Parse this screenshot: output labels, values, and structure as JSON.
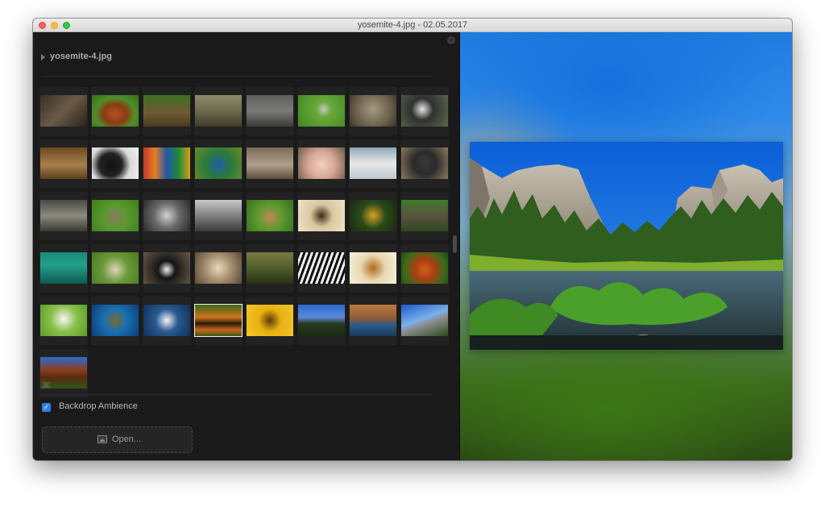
{
  "window": {
    "title": "yosemite-4.jpg - 02.05.2017"
  },
  "sidebar": {
    "file_name": "yosemite-4.jpg",
    "cmd_symbol": "⌘",
    "backdrop_label": "Backdrop Ambience",
    "backdrop_checked": true,
    "checkmark": "✓",
    "open_label": "Open...",
    "selected_index": 35,
    "thumbnails": [
      {
        "name": "thumb-hedgehog",
        "bg": "linear-gradient(135deg,#3a3025,#6a5a48 50%,#2a2218)"
      },
      {
        "name": "thumb-orangutan",
        "bg": "radial-gradient(ellipse at 50% 60%,#b5531d 0%,#8a3a14 35%,#4f8f2a 60%,#3a6d1e 100%)"
      },
      {
        "name": "thumb-deer",
        "bg": "linear-gradient(180deg,#3d6e1f,#6f5a34 55%,#4a3a20)"
      },
      {
        "name": "thumb-crocodile",
        "bg": "linear-gradient(180deg,#8e8a6a,#6e6a4e 50%,#3f3c2a)"
      },
      {
        "name": "thumb-rhino",
        "bg": "linear-gradient(180deg,#606060,#7a7a78 50%,#3b3b3a)"
      },
      {
        "name": "thumb-ostrich",
        "bg": "radial-gradient(circle at 55% 45%,#c7c7c7 0%,#6aa83a 25%,#3f8a22 100%)"
      },
      {
        "name": "thumb-owl",
        "bg": "radial-gradient(circle at 50% 45%,#a59a82,#6a604c 60%,#3a3428)"
      },
      {
        "name": "thumb-panda",
        "bg": "radial-gradient(circle at 45% 45%,#e8e8e8 0%,#303030 35%,#5c6a4e 100%)"
      },
      {
        "name": "thumb-meerkats",
        "bg": "linear-gradient(180deg,#6b4a22,#a8804a 55%,#5a4020)"
      },
      {
        "name": "thumb-bear",
        "bg": "radial-gradient(circle at 40% 55%,#111 0%,#222 35%,#d9d9d9 60%,#f0f0f0 100%)"
      },
      {
        "name": "thumb-parrots",
        "bg": "linear-gradient(90deg,#c0392b,#e67e22 25%,#2255aa 50%,#1e8a3a 75%,#d4a017)"
      },
      {
        "name": "thumb-peacock",
        "bg": "radial-gradient(circle at 50% 55%,#1d5fa8,#2a7a3a 45%,#6a8a2a 100%)"
      },
      {
        "name": "thumb-seal",
        "bg": "linear-gradient(180deg,#7a6a58,#b0a08a 55%,#5a4e40)"
      },
      {
        "name": "thumb-pig",
        "bg": "radial-gradient(circle at 50% 55%,#f2cfc0,#d8a898 45%,#6a5a4a 100%)"
      },
      {
        "name": "thumb-polar-bears",
        "bg": "linear-gradient(180deg,#8fa8b8,#e8e8e8 50%,#bfc8d0)"
      },
      {
        "name": "thumb-porcupine",
        "bg": "radial-gradient(circle at 50% 50%,#3a3a3a,#2a2a2a 40%,#8a7a60 100%)"
      },
      {
        "name": "thumb-opossum",
        "bg": "linear-gradient(180deg,#4a4a44,#8a8a80 50%,#3a3a34)"
      },
      {
        "name": "thumb-rabbit",
        "bg": "radial-gradient(circle at 50% 55%,#8a7a60,#5a9a2e 40%,#3e7f1f 100%)"
      },
      {
        "name": "thumb-raccoon",
        "bg": "radial-gradient(circle at 50% 50%,#d0d0d0,#6a6a6a 45%,#2a2a2a 100%)"
      },
      {
        "name": "thumb-rat",
        "bg": "linear-gradient(180deg,#c8c8c8,#7a7a7a 55%,#3a3a3a)"
      },
      {
        "name": "thumb-deer-fawns",
        "bg": "radial-gradient(circle at 50% 55%,#c08850,#5a9a2e 45%,#3a6e1c 100%)"
      },
      {
        "name": "thumb-scorpion",
        "bg": "radial-gradient(circle at 50% 50%,#3a2a10,#d8c8a0 40%,#efe4c8 100%)"
      },
      {
        "name": "thumb-seahorse",
        "bg": "radial-gradient(circle at 50% 50%,#d9a020,#2a4a1a 45%,#1a2a10 100%)"
      },
      {
        "name": "thumb-sea-lion",
        "bg": "linear-gradient(180deg,#3f7a2a,#5a5040 55%,#2a4a1e)"
      },
      {
        "name": "thumb-shark",
        "bg": "linear-gradient(180deg,#1a8a7a,#22a08a 40%,#0e5a50)"
      },
      {
        "name": "thumb-sheep",
        "bg": "radial-gradient(circle at 50% 55%,#e0d0b8,#6a9a3a 45%,#4a7a22 100%)"
      },
      {
        "name": "thumb-skunk",
        "bg": "radial-gradient(circle at 50% 55%,#f0f0f0 0%,#151515 30%,#6a5a48 100%)"
      },
      {
        "name": "thumb-snail",
        "bg": "radial-gradient(circle at 50% 50%,#e8d8c0,#a89070 45%,#5a4a38 100%)"
      },
      {
        "name": "thumb-frog",
        "bg": "linear-gradient(180deg,#7a7a40,#4a5a2a 55%,#2a3018)"
      },
      {
        "name": "thumb-zebra",
        "bg": "repeating-linear-gradient(110deg,#111 0 3px,#eee 3px 6px)"
      },
      {
        "name": "thumb-spider",
        "bg": "radial-gradient(circle at 50% 50%,#b06a20,#e8d8b0 45%,#f6f0e0 100%)"
      },
      {
        "name": "thumb-squirrel",
        "bg": "radial-gradient(circle at 50% 55%,#d2601a,#a84010 35%,#3a6a1c 70%,#224a10 100%)"
      },
      {
        "name": "thumb-stork",
        "bg": "radial-gradient(circle at 50% 45%,#f6f6f6,#8ac04a 45%,#5a9a2a 100%)"
      },
      {
        "name": "thumb-turtle",
        "bg": "radial-gradient(circle at 50% 50%,#7a6a30,#1a70b0 40%,#0a3f7a 100%)"
      },
      {
        "name": "thumb-swan",
        "bg": "radial-gradient(circle at 50% 50%,#f4f4f4,#2a5a90 40%,#0f2f5a 100%)"
      },
      {
        "name": "thumb-tiger",
        "bg": "linear-gradient(180deg,#3a6a1a,#d0741a 40%,#2a1a08 60%,#c8681a 80%,#3a5a18)"
      },
      {
        "name": "thumb-sunflower",
        "bg": "radial-gradient(circle at 50% 50%,#5a3a10 0%,#e8b010 40%,#f3c82a 100%)"
      },
      {
        "name": "thumb-valley",
        "bg": "linear-gradient(180deg,#2a6ad0,#5a8ad8 40%,#2a3a20 60%,#1a2a14)"
      },
      {
        "name": "thumb-cliff",
        "bg": "linear-gradient(180deg,#c07a40,#8a5a3a 45%,#2a5a8a 65%,#1a3a5a)"
      },
      {
        "name": "thumb-el-capitan",
        "bg": "linear-gradient(160deg,#1a5ad0,#7ab0e8 45%,#8a8a8a 60%,#2a4a1a)"
      },
      {
        "name": "thumb-sequoia",
        "bg": "linear-gradient(180deg,#2a6ad8,#8a4020 40%,#5a2a10 65%,#2a5a1a)"
      }
    ]
  },
  "preview": {
    "alt": "yosemite-4.jpg"
  }
}
